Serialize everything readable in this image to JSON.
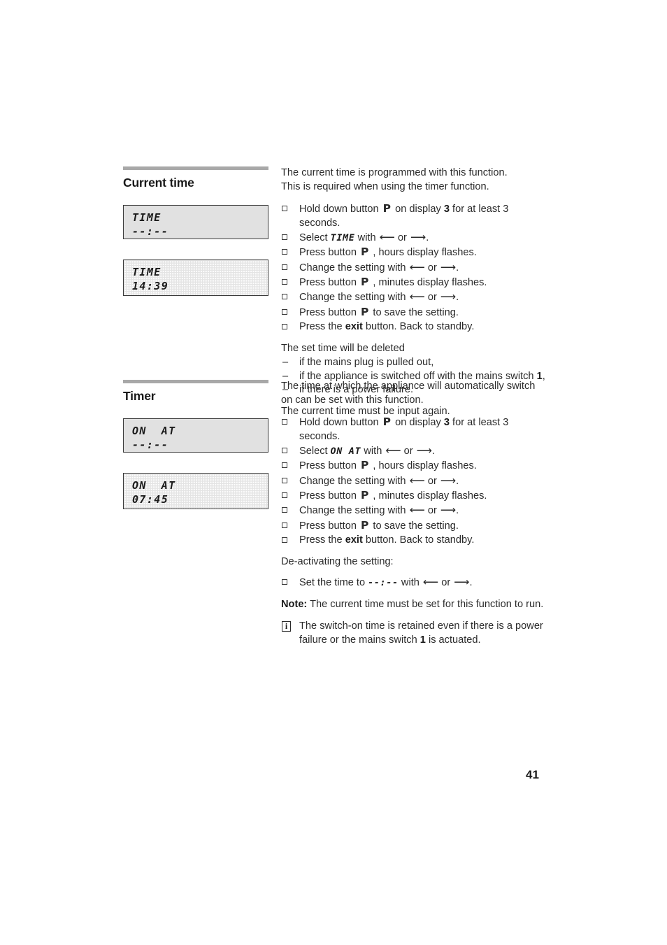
{
  "page": {
    "number": "41"
  },
  "sections": [
    {
      "id": "current-time",
      "title": "Current time",
      "displays": [
        {
          "style": "plain",
          "line1": "TIME",
          "line2": "--:--"
        },
        {
          "style": "dots",
          "line1": "TIME",
          "line2": "14:39"
        }
      ],
      "intro": [
        "The current time is programmed with this function.",
        "This is required when using the timer function."
      ],
      "steps": [
        {
          "parts": [
            {
              "t": "text",
              "v": "Hold down button "
            },
            {
              "t": "btn",
              "v": "P"
            },
            {
              "t": "text",
              "v": " on display "
            },
            {
              "t": "bold",
              "v": "3"
            },
            {
              "t": "text",
              "v": " for at least 3 seconds."
            }
          ]
        },
        {
          "parts": [
            {
              "t": "text",
              "v": "Select "
            },
            {
              "t": "lcd",
              "v": "TIME"
            },
            {
              "t": "text",
              "v": " with "
            },
            {
              "t": "arrow",
              "v": "⟵"
            },
            {
              "t": "text",
              "v": " or "
            },
            {
              "t": "arrow",
              "v": "⟶"
            },
            {
              "t": "text",
              "v": "."
            }
          ]
        },
        {
          "parts": [
            {
              "t": "text",
              "v": "Press button "
            },
            {
              "t": "btn",
              "v": "P"
            },
            {
              "t": "text",
              "v": " , hours display flashes."
            }
          ]
        },
        {
          "parts": [
            {
              "t": "text",
              "v": "Change the setting with "
            },
            {
              "t": "arrow",
              "v": "⟵"
            },
            {
              "t": "text",
              "v": " or "
            },
            {
              "t": "arrow",
              "v": "⟶"
            },
            {
              "t": "text",
              "v": "."
            }
          ]
        },
        {
          "parts": [
            {
              "t": "text",
              "v": "Press button "
            },
            {
              "t": "btn",
              "v": "P"
            },
            {
              "t": "text",
              "v": " , minutes display flashes."
            }
          ]
        },
        {
          "parts": [
            {
              "t": "text",
              "v": "Change the setting with "
            },
            {
              "t": "arrow",
              "v": "⟵"
            },
            {
              "t": "text",
              "v": " or "
            },
            {
              "t": "arrow",
              "v": "⟶"
            },
            {
              "t": "text",
              "v": "."
            }
          ]
        },
        {
          "parts": [
            {
              "t": "text",
              "v": "Press button "
            },
            {
              "t": "btn",
              "v": "P"
            },
            {
              "t": "text",
              "v": " to save the setting."
            }
          ]
        },
        {
          "parts": [
            {
              "t": "text",
              "v": "Press the "
            },
            {
              "t": "bold",
              "v": "exit"
            },
            {
              "t": "text",
              "v": " button. Back to standby."
            }
          ]
        }
      ],
      "delete_heading": "The set time will be deleted",
      "delete_items": [
        {
          "parts": [
            {
              "t": "text",
              "v": "if the mains plug is pulled out,"
            }
          ]
        },
        {
          "parts": [
            {
              "t": "text",
              "v": "if the appliance is switched off with the mains switch "
            },
            {
              "t": "bold",
              "v": "1"
            },
            {
              "t": "text",
              "v": ","
            }
          ]
        },
        {
          "parts": [
            {
              "t": "text",
              "v": "if there is a power failure."
            }
          ]
        }
      ],
      "outro": "The current time must be input again."
    },
    {
      "id": "timer",
      "title": "Timer",
      "displays": [
        {
          "style": "plain",
          "line1": "ON  AT",
          "line2": "--:--"
        },
        {
          "style": "dots",
          "line1": "ON  AT",
          "line2": "07:45"
        }
      ],
      "intro": [
        "The time at which the appliance will automatically switch",
        "on can be set with this function."
      ],
      "steps": [
        {
          "parts": [
            {
              "t": "text",
              "v": "Hold down button "
            },
            {
              "t": "btn",
              "v": "P"
            },
            {
              "t": "text",
              "v": " on display "
            },
            {
              "t": "bold",
              "v": "3"
            },
            {
              "t": "text",
              "v": " for at least 3 seconds."
            }
          ]
        },
        {
          "parts": [
            {
              "t": "text",
              "v": "Select "
            },
            {
              "t": "lcd",
              "v": "ON  AT"
            },
            {
              "t": "text",
              "v": " with "
            },
            {
              "t": "arrow",
              "v": "⟵"
            },
            {
              "t": "text",
              "v": " or "
            },
            {
              "t": "arrow",
              "v": "⟶"
            },
            {
              "t": "text",
              "v": "."
            }
          ]
        },
        {
          "parts": [
            {
              "t": "text",
              "v": "Press button "
            },
            {
              "t": "btn",
              "v": "P"
            },
            {
              "t": "text",
              "v": " , hours display flashes."
            }
          ]
        },
        {
          "parts": [
            {
              "t": "text",
              "v": "Change the setting with "
            },
            {
              "t": "arrow",
              "v": "⟵"
            },
            {
              "t": "text",
              "v": " or "
            },
            {
              "t": "arrow",
              "v": "⟶"
            },
            {
              "t": "text",
              "v": "."
            }
          ]
        },
        {
          "parts": [
            {
              "t": "text",
              "v": "Press button "
            },
            {
              "t": "btn",
              "v": "P"
            },
            {
              "t": "text",
              "v": " , minutes display flashes."
            }
          ]
        },
        {
          "parts": [
            {
              "t": "text",
              "v": "Change the setting with "
            },
            {
              "t": "arrow",
              "v": "⟵"
            },
            {
              "t": "text",
              "v": " or "
            },
            {
              "t": "arrow",
              "v": "⟶"
            },
            {
              "t": "text",
              "v": "."
            }
          ]
        },
        {
          "parts": [
            {
              "t": "text",
              "v": "Press button "
            },
            {
              "t": "btn",
              "v": "P"
            },
            {
              "t": "text",
              "v": " to save the setting."
            }
          ]
        },
        {
          "parts": [
            {
              "t": "text",
              "v": "Press the "
            },
            {
              "t": "bold",
              "v": "exit"
            },
            {
              "t": "text",
              "v": " button. Back to standby."
            }
          ]
        }
      ],
      "deactivate_heading": "De-activating the setting:",
      "deactivate_steps": [
        {
          "parts": [
            {
              "t": "text",
              "v": "Set the time to "
            },
            {
              "t": "lcd",
              "v": "--:--"
            },
            {
              "t": "text",
              "v": " with "
            },
            {
              "t": "arrow",
              "v": "⟵"
            },
            {
              "t": "text",
              "v": " or "
            },
            {
              "t": "arrow",
              "v": "⟶"
            },
            {
              "t": "text",
              "v": "."
            }
          ]
        }
      ],
      "note": {
        "label": "Note:",
        "text": " The current time must be set for this function to run."
      },
      "info": {
        "icon": "i",
        "parts": [
          {
            "t": "text",
            "v": "The switch-on time is retained even if there is a power failure or the mains switch "
          },
          {
            "t": "bold",
            "v": "1"
          },
          {
            "t": "text",
            "v": " is actuated."
          }
        ]
      }
    }
  ]
}
